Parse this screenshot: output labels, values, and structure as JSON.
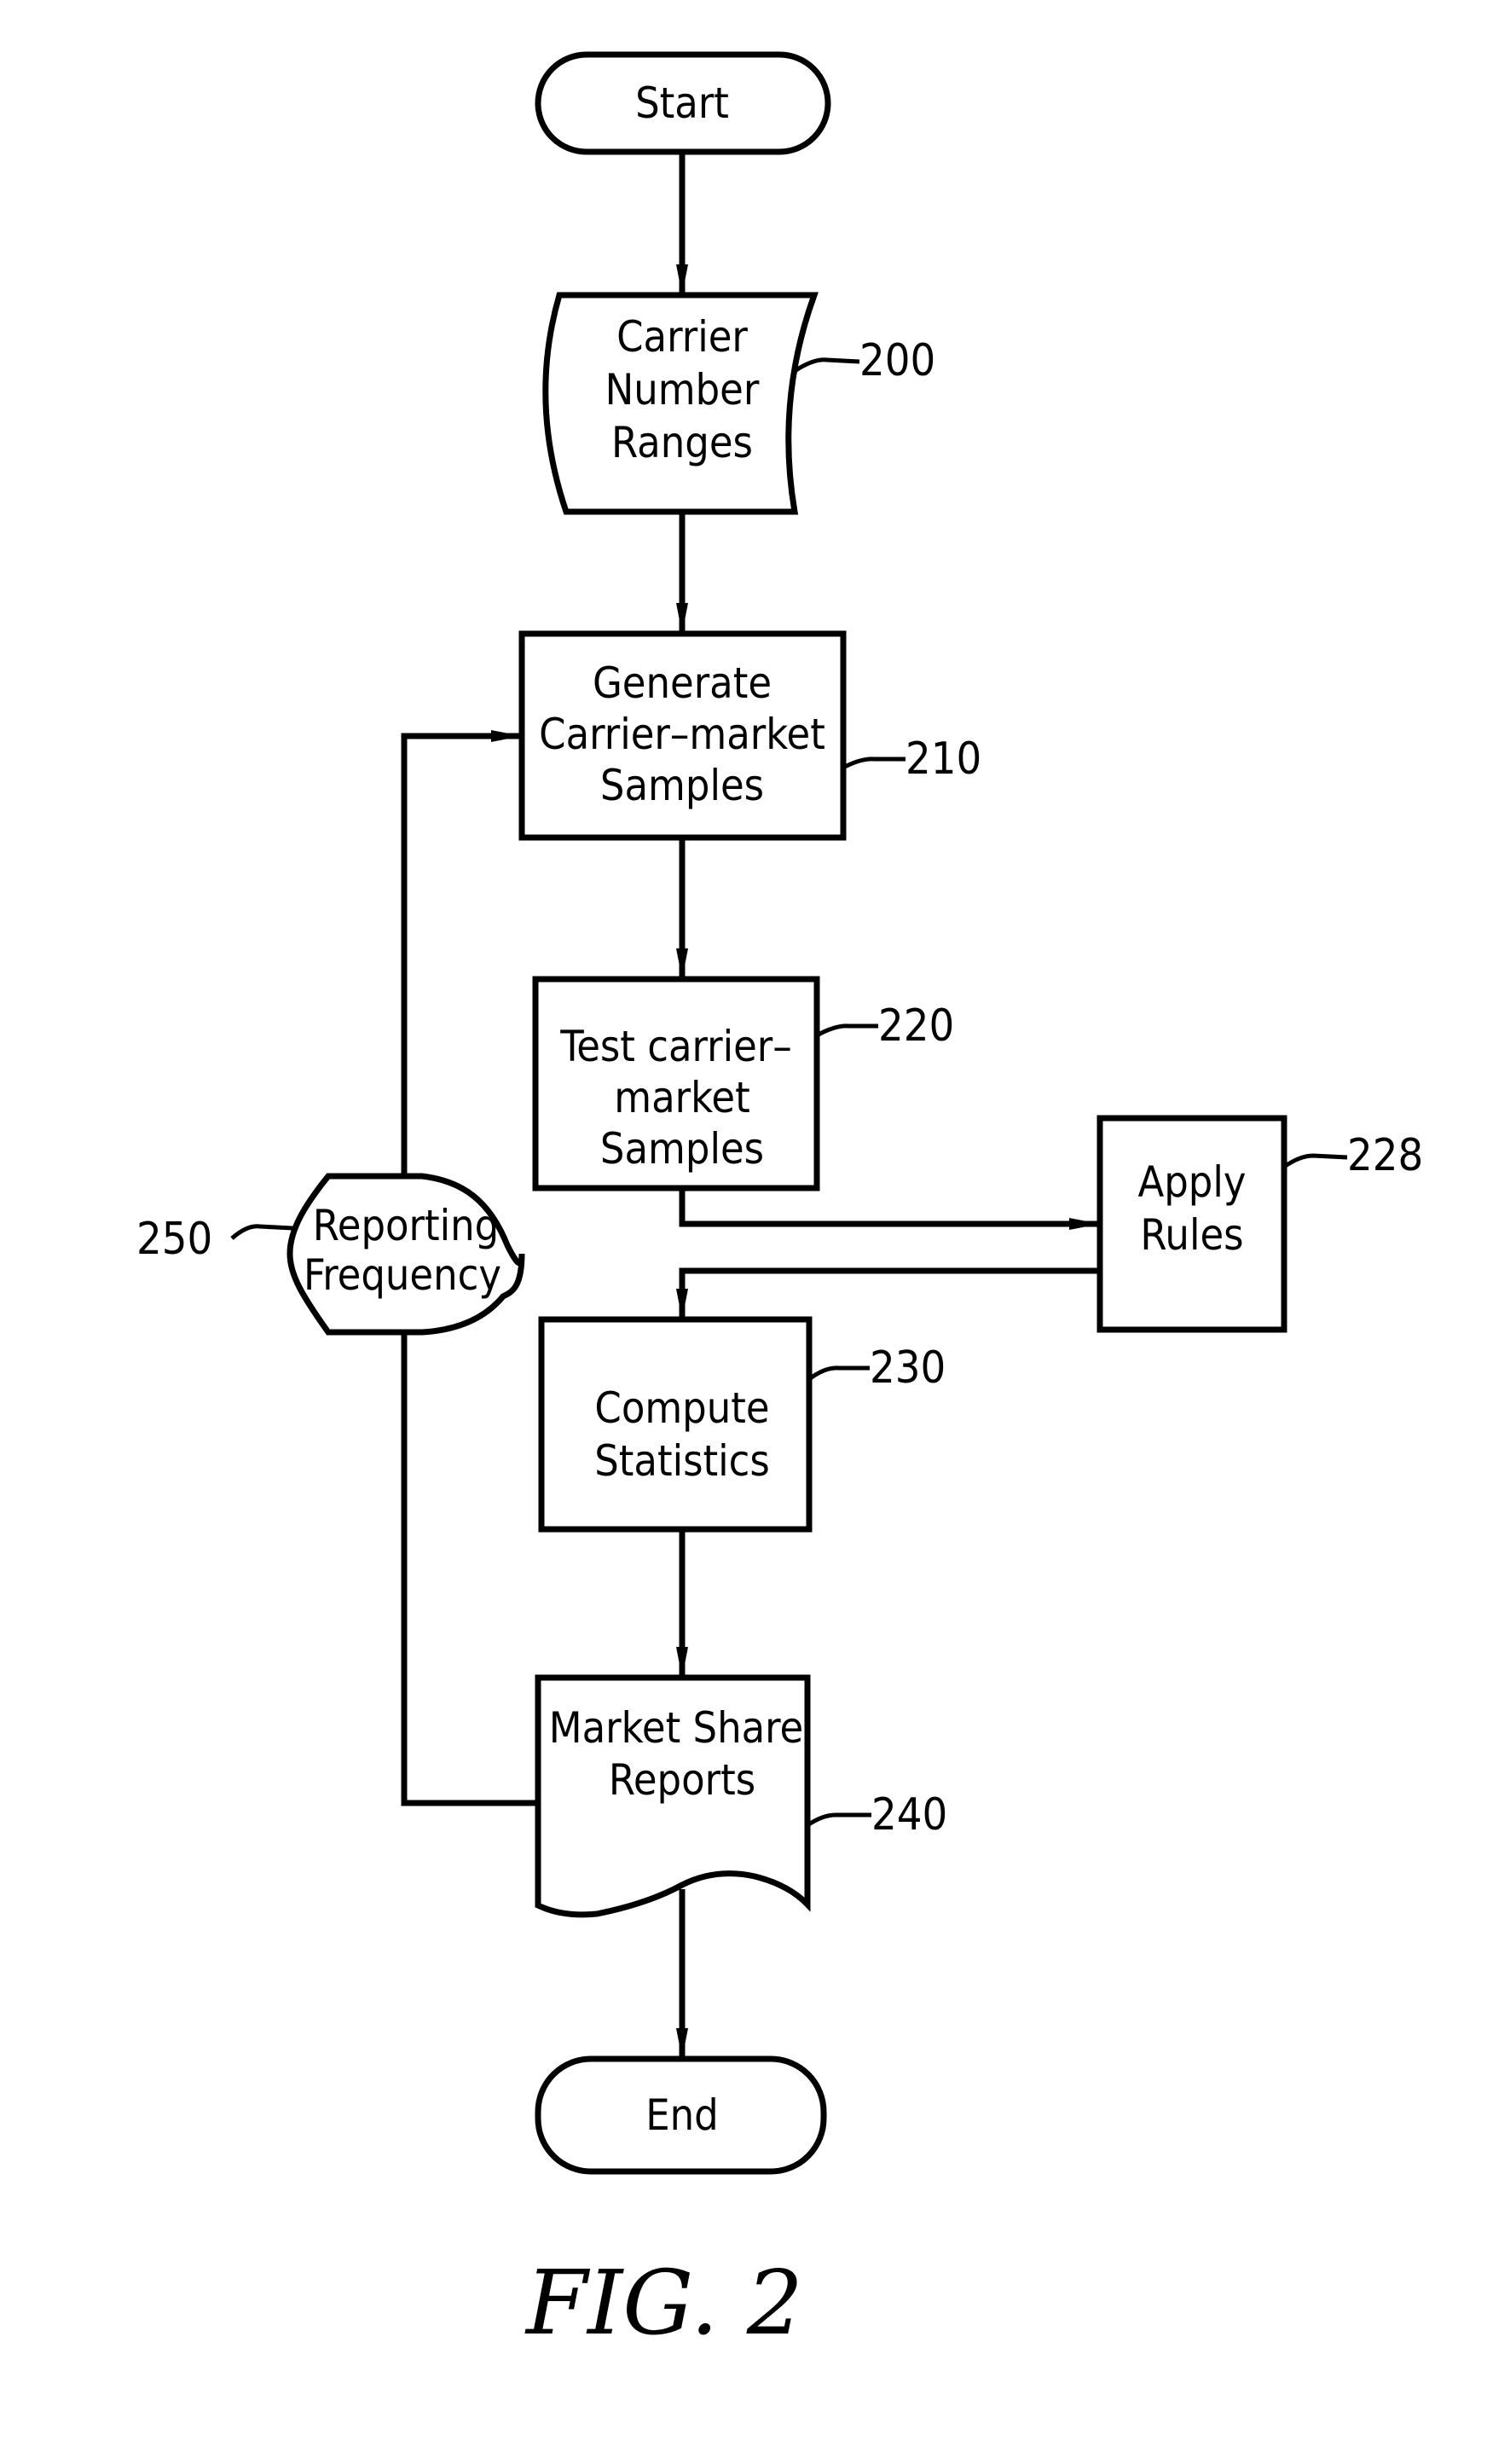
{
  "figure_label": "FIG. 2",
  "nodes": {
    "start": {
      "lines": [
        "Start"
      ]
    },
    "carrier_ranges": {
      "lines": [
        "Carrier",
        "Number",
        "Ranges"
      ],
      "ref": "200"
    },
    "generate": {
      "lines": [
        "Generate",
        "Carrier–market",
        "Samples"
      ],
      "ref": "210"
    },
    "test": {
      "lines": [
        "Test  carrier–",
        "market",
        "Samples"
      ],
      "ref": "220"
    },
    "apply": {
      "lines": [
        "Apply",
        "Rules"
      ],
      "ref": "228"
    },
    "compute": {
      "lines": [
        "Compute",
        "Statistics"
      ],
      "ref": "230"
    },
    "reports": {
      "lines": [
        "Market  Share",
        "Reports"
      ],
      "ref": "240"
    },
    "frequency": {
      "lines": [
        "Reporting",
        "Frequency"
      ],
      "ref": "250"
    },
    "end": {
      "lines": [
        "End"
      ]
    }
  }
}
